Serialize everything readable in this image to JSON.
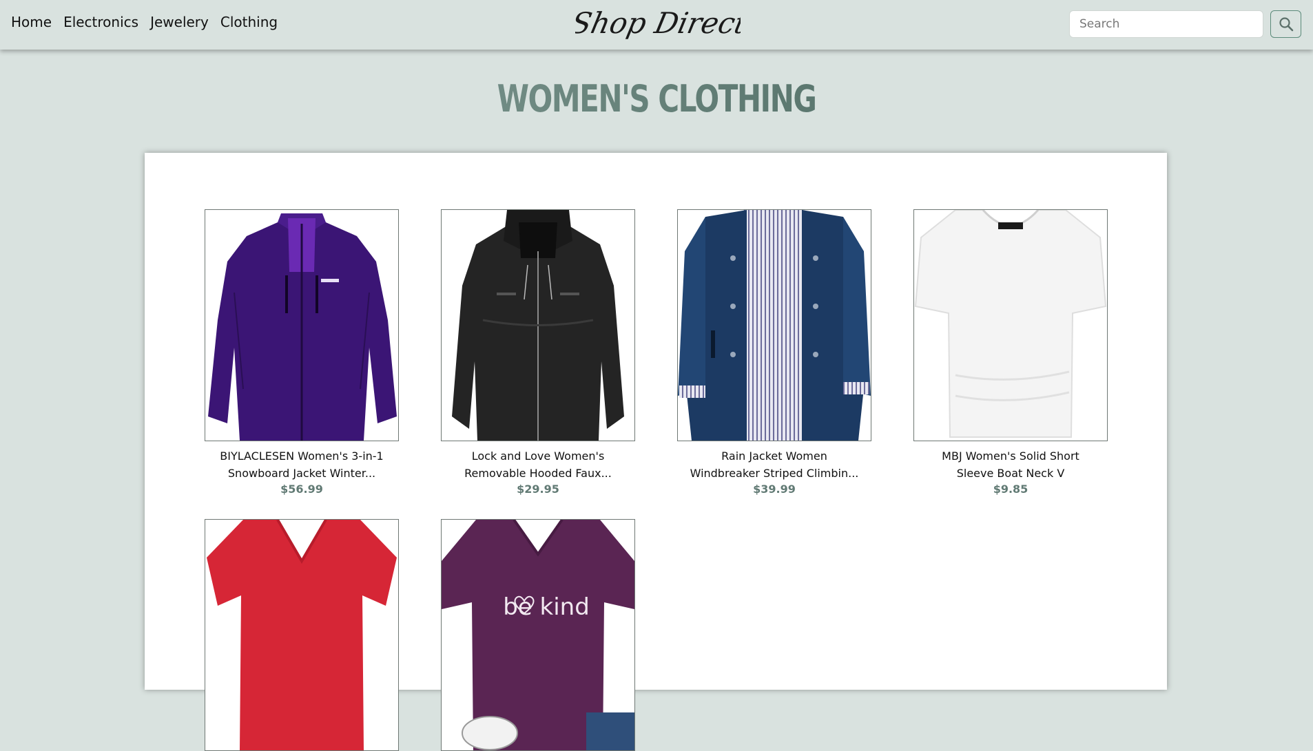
{
  "nav": {
    "links": [
      "Home",
      "Electronics",
      "Jewelery",
      "Clothing"
    ],
    "logo_text": "Shop Direct"
  },
  "search": {
    "placeholder": "Search",
    "button_icon": "search-icon"
  },
  "page": {
    "heading": "WOMEN'S CLOTHING"
  },
  "products": [
    {
      "title_line1": "BIYLACLESEN Women's 3-in-1",
      "title_line2": "Snowboard Jacket Winter...",
      "price": "$56.99",
      "image": "purple-jacket"
    },
    {
      "title_line1": "Lock and Love Women's",
      "title_line2": "Removable Hooded Faux...",
      "price": "$29.95",
      "image": "black-leather-jacket"
    },
    {
      "title_line1": "Rain Jacket Women",
      "title_line2": "Windbreaker Striped Climbin...",
      "price": "$39.99",
      "image": "navy-rain-jacket"
    },
    {
      "title_line1": "MBJ Women's Solid Short",
      "title_line2": "Sleeve Boat Neck V",
      "price": "$9.85",
      "image": "white-tshirt"
    },
    {
      "title_line1": "",
      "title_line2": "",
      "price": "",
      "image": "red-vneck-tshirt"
    },
    {
      "title_line1": "",
      "title_line2": "",
      "price": "",
      "image": "purple-be-kind-tshirt",
      "image_text": "be kind"
    }
  ],
  "colors": {
    "background": "#d9e2df",
    "accent": "#617a74",
    "search_border": "#5b8a7a"
  }
}
